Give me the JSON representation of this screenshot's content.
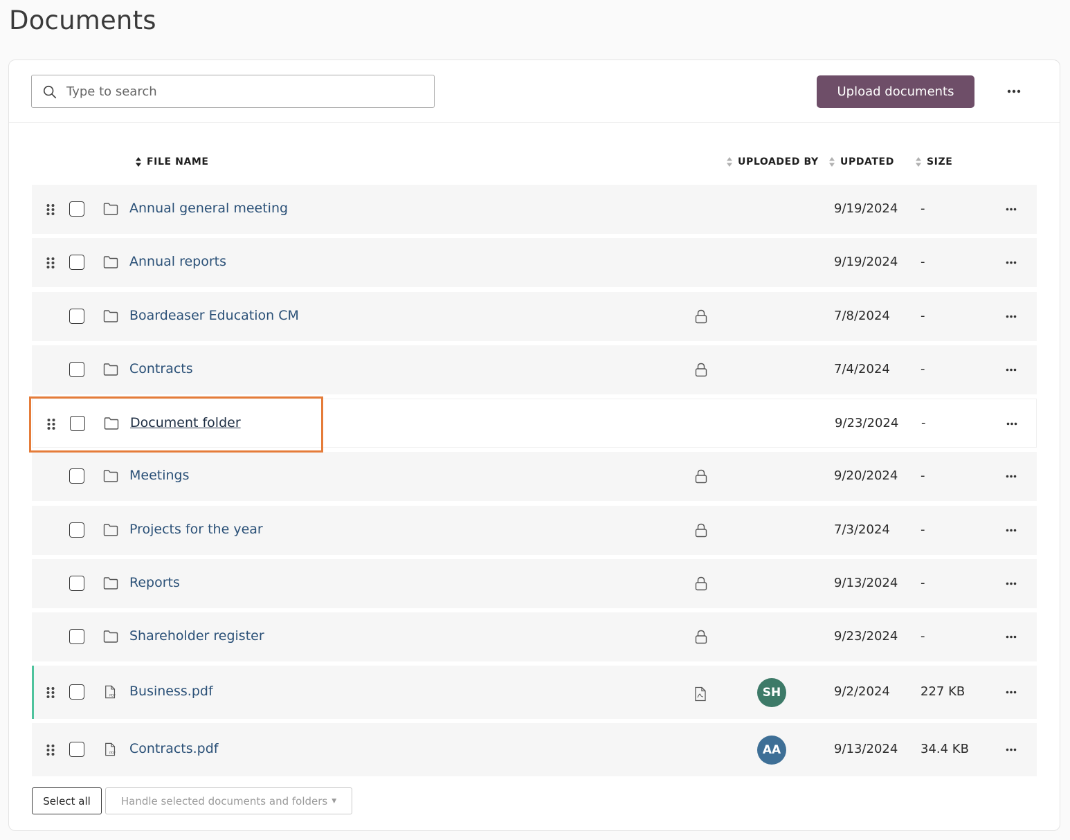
{
  "page": {
    "title": "Documents"
  },
  "toolbar": {
    "search_placeholder": "Type to search",
    "upload_label": "Upload documents",
    "more_icon": "more-horizontal-icon",
    "upload_color": "#6e4e68"
  },
  "table": {
    "columns": {
      "file_name": "FILE NAME",
      "uploaded_by": "UPLOADED BY",
      "updated": "UPDATED",
      "size": "SIZE"
    },
    "rows": [
      {
        "name": "Annual general meeting",
        "type": "folder",
        "draggable": true,
        "locked": false,
        "uploaded_by": "",
        "updated": "9/19/2024",
        "size": "-"
      },
      {
        "name": "Annual reports",
        "type": "folder",
        "draggable": true,
        "locked": false,
        "uploaded_by": "",
        "updated": "9/19/2024",
        "size": "-"
      },
      {
        "name": "Boardeaser Education CM",
        "type": "folder",
        "draggable": false,
        "locked": true,
        "uploaded_by": "",
        "updated": "7/8/2024",
        "size": "-"
      },
      {
        "name": "Contracts",
        "type": "folder",
        "draggable": false,
        "locked": true,
        "uploaded_by": "",
        "updated": "7/4/2024",
        "size": "-"
      },
      {
        "name": "Document folder",
        "type": "folder",
        "draggable": true,
        "locked": false,
        "uploaded_by": "",
        "updated": "9/23/2024",
        "size": "-",
        "hovered": true
      },
      {
        "name": "Meetings",
        "type": "folder",
        "draggable": false,
        "locked": true,
        "uploaded_by": "",
        "updated": "9/20/2024",
        "size": "-"
      },
      {
        "name": "Projects for the year",
        "type": "folder",
        "draggable": false,
        "locked": true,
        "uploaded_by": "",
        "updated": "7/3/2024",
        "size": "-"
      },
      {
        "name": "Reports",
        "type": "folder",
        "draggable": false,
        "locked": true,
        "uploaded_by": "",
        "updated": "9/13/2024",
        "size": "-"
      },
      {
        "name": "Shareholder register",
        "type": "folder",
        "draggable": false,
        "locked": true,
        "uploaded_by": "",
        "updated": "9/23/2024",
        "size": "-"
      },
      {
        "name": "Business.pdf",
        "type": "pdf",
        "draggable": true,
        "locked": false,
        "uploaded_by": "SH",
        "avatar_color": "#3d7a68",
        "updated": "9/2/2024",
        "size": "227 KB",
        "accent": true
      },
      {
        "name": "Contracts.pdf",
        "type": "pdf",
        "draggable": true,
        "locked": false,
        "uploaded_by": "AA",
        "avatar_color": "#3e6f96",
        "updated": "9/13/2024",
        "size": "34.4 KB"
      }
    ]
  },
  "footer": {
    "select_all": "Select all",
    "handle_selected": "Handle selected documents and folders"
  },
  "colors": {
    "link": "#2a5077",
    "highlight": "#e57c39",
    "accent_bar": "#4fc39d"
  }
}
